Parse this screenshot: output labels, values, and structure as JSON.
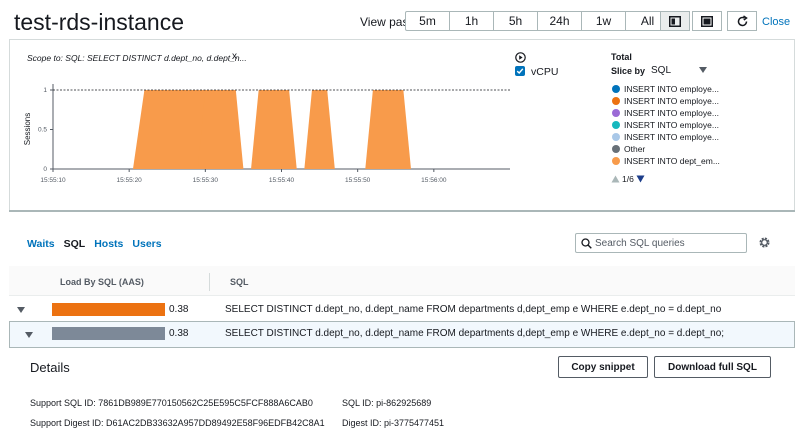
{
  "header": {
    "title": "test-rds-instance",
    "view_past_label": "View past",
    "ranges": [
      "5m",
      "1h",
      "5h",
      "24h",
      "1w",
      "All"
    ],
    "close_label": "Close"
  },
  "scope": {
    "text": "Scope to: SQL: SELECT DISTINCT d.dept_no, d.dept_n...",
    "remove": "x"
  },
  "vcpu": {
    "label": "vCPU",
    "checked": true
  },
  "chart_data": {
    "type": "area",
    "ylabel": "Sessions",
    "y_ticks": [
      "0",
      "0.5",
      "1"
    ],
    "ylim": [
      0,
      1
    ],
    "x_ticks": [
      "15:55:10",
      "15:55:20",
      "15:55:30",
      "15:55:40",
      "15:55:50",
      "15:56:00"
    ],
    "x_range_seconds": [
      0,
      60
    ],
    "series": [
      {
        "color": "#f89b4b",
        "segments": [
          [
            10.5,
            12,
            22,
            23.5
          ],
          [
            19,
            20,
            24,
            25
          ],
          [
            26,
            27,
            31,
            32
          ],
          [
            33,
            34,
            36,
            37
          ],
          [
            41,
            42,
            46,
            47
          ]
        ]
      }
    ],
    "max_line": 1
  },
  "legend": {
    "total_label": "Total",
    "slice_label": "Slice by",
    "slice_value": "SQL",
    "items": [
      {
        "label": "INSERT INTO employe...",
        "color": "#0073bb"
      },
      {
        "label": "INSERT INTO employe...",
        "color": "#ec7211"
      },
      {
        "label": "INSERT INTO employe...",
        "color": "#9b6ad6"
      },
      {
        "label": "INSERT INTO employe...",
        "color": "#17b8be"
      },
      {
        "label": "INSERT INTO employe...",
        "color": "#a9c8e8"
      },
      {
        "label": "Other",
        "color": "#687078"
      },
      {
        "label": "INSERT INTO dept_em...",
        "color": "#f89b4b"
      }
    ],
    "pager": "1/6"
  },
  "tabs": [
    {
      "label": "Waits",
      "active": false
    },
    {
      "label": "SQL",
      "active": true
    },
    {
      "label": "Hosts",
      "active": false
    },
    {
      "label": "Users",
      "active": false
    }
  ],
  "search": {
    "placeholder": "Search SQL queries"
  },
  "table": {
    "col_load": "Load By SQL (AAS)",
    "col_sql": "SQL",
    "rows": [
      {
        "value": "0.38",
        "load": 0.38,
        "color": "#ec7211",
        "sql": "SELECT DISTINCT d.dept_no, d.dept_name FROM departments d,dept_emp e WHERE e.dept_no = d.dept_no"
      },
      {
        "value": "0.38",
        "load": 0.38,
        "color": "#7d8998",
        "sql": "SELECT DISTINCT d.dept_no, d.dept_name FROM departments d,dept_emp e WHERE e.dept_no = d.dept_no;"
      }
    ]
  },
  "details": {
    "title": "Details",
    "copy_label": "Copy snippet",
    "download_label": "Download full SQL",
    "support_sql_id": "Support SQL ID: 7861DB989E770150562C25E595C5FCF888A6CAB0",
    "sql_id": "SQL ID: pi-862925689",
    "support_digest_id": "Support Digest ID: D61AC2DB33632A957DD89492E58F96EDFB42C8A1",
    "digest_id": "Digest ID: pi-3775477451"
  }
}
